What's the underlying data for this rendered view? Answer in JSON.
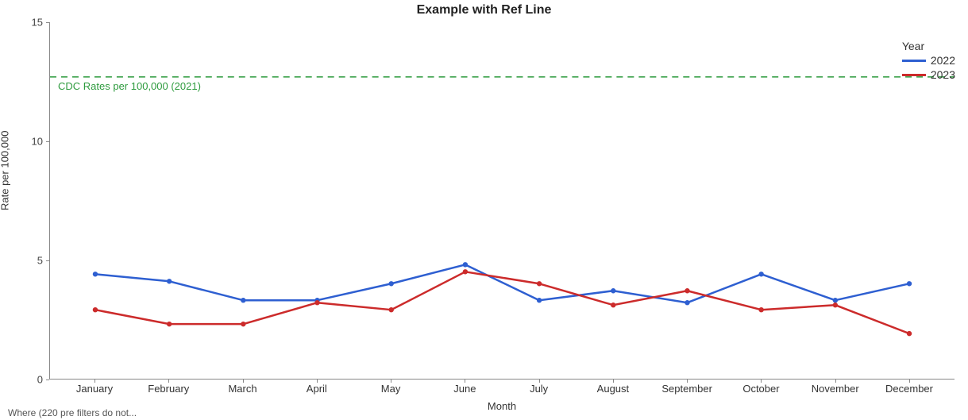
{
  "chart_data": {
    "type": "line",
    "title": "Example with Ref Line",
    "xlabel": "Month",
    "ylabel": "Rate per 100,000",
    "ylim": [
      0,
      15
    ],
    "yticks": [
      0,
      5,
      10,
      15
    ],
    "categories": [
      "January",
      "February",
      "March",
      "April",
      "May",
      "June",
      "July",
      "August",
      "September",
      "October",
      "November",
      "December"
    ],
    "series": [
      {
        "name": "2022",
        "color": "#2e5fd1",
        "values": [
          4.4,
          4.1,
          3.3,
          3.3,
          4.0,
          4.8,
          3.3,
          3.7,
          3.2,
          4.4,
          3.3,
          4.0
        ]
      },
      {
        "name": "2023",
        "color": "#cc2b2b",
        "values": [
          2.9,
          2.3,
          2.3,
          3.2,
          2.9,
          4.5,
          4.0,
          3.1,
          3.7,
          2.9,
          3.1,
          1.9
        ]
      }
    ],
    "reference_line": {
      "value": 12.7,
      "label": "CDC Rates per 100,000 (2021)",
      "color": "#2e9b3e",
      "style": "dashed"
    },
    "legend_title": "Year",
    "legend_position": "top-right"
  },
  "footer_where": "Where (220 pre filters do not..."
}
